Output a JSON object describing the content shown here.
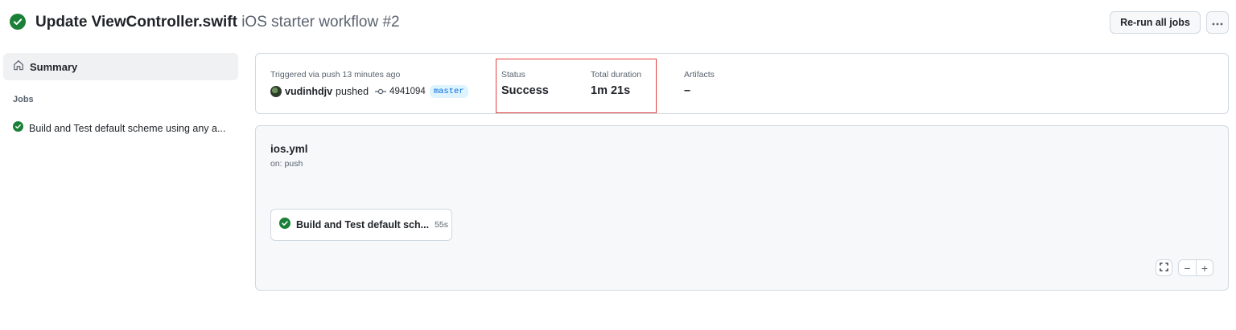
{
  "header": {
    "title_bold": "Update ViewController.swift",
    "title_rest": "iOS starter workflow #2",
    "rerun_label": "Re-run all jobs",
    "more_icon": "kebab-horizontal-icon",
    "status_icon": "check-circle-icon"
  },
  "sidebar": {
    "summary_label": "Summary",
    "summary_icon": "home-icon",
    "jobs_heading": "Jobs",
    "jobs": [
      {
        "label": "Build and Test default scheme using any a...",
        "status": "success"
      }
    ]
  },
  "run_info": {
    "trigger_label": "Triggered via push 13 minutes ago",
    "user": "vudinhdjv",
    "action": "pushed",
    "commit_sha": "4941094",
    "branch": "master",
    "status_label": "Status",
    "status_value": "Success",
    "duration_label": "Total duration",
    "duration_value": "1m 21s",
    "artifacts_label": "Artifacts",
    "artifacts_value": "–"
  },
  "graph": {
    "workflow_file": "ios.yml",
    "workflow_trigger": "on: push",
    "jobs": [
      {
        "name": "Build and Test default sch...",
        "duration": "55s",
        "status": "success"
      }
    ],
    "controls": {
      "fullscreen_icon": "screen-full-icon",
      "zoom_out": "−",
      "zoom_in": "+"
    }
  },
  "colors": {
    "success": "#1a7f37",
    "highlight": "#e0413e",
    "branch_bg": "#ddf4ff",
    "branch_fg": "#0969da"
  }
}
